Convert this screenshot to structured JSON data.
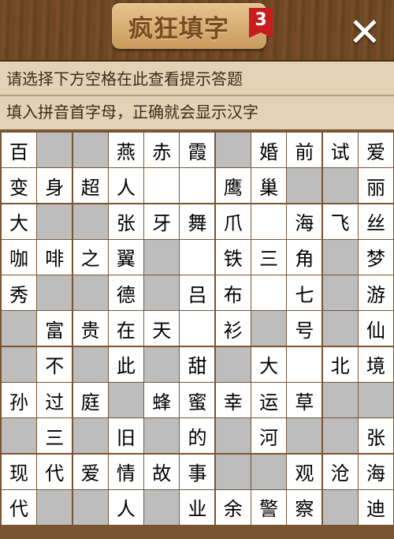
{
  "header": {
    "title": "疯狂填字",
    "level": "3",
    "close_label": "✕"
  },
  "hint": {
    "line1": "请选择下方空格在此查看提示答题",
    "line2": "填入拼音首字母，正确就会显示汉字"
  },
  "grid": {
    "rows": [
      [
        "百",
        null,
        null,
        "燕",
        "赤",
        "霞",
        null,
        "婚",
        "前",
        "试",
        "爱"
      ],
      [
        "变",
        "身",
        "超",
        "人",
        "",
        "",
        "鹰",
        "巢",
        null,
        null,
        "丽"
      ],
      [
        "大",
        null,
        null,
        "张",
        "牙",
        "舞",
        "爪",
        "",
        "海",
        "飞",
        "丝"
      ],
      [
        "咖",
        "啡",
        "之",
        "翼",
        null,
        "",
        "铁",
        "三",
        "角",
        null,
        "梦"
      ],
      [
        "秀",
        null,
        null,
        "德",
        null,
        "吕",
        "布",
        "",
        "七",
        null,
        "游"
      ],
      [
        null,
        "富",
        "贵",
        "在",
        "天",
        "",
        "衫",
        null,
        "号",
        null,
        "仙"
      ],
      [
        null,
        "不",
        null,
        "此",
        null,
        "甜",
        null,
        "大",
        "",
        "北",
        "境"
      ],
      [
        "孙",
        "过",
        "庭",
        null,
        "蜂",
        "蜜",
        "幸",
        "运",
        "草",
        null,
        null
      ],
      [
        null,
        "三",
        null,
        "旧",
        null,
        "的",
        null,
        "河",
        null,
        null,
        "张"
      ],
      [
        "现",
        "代",
        "爱",
        "情",
        "故",
        "事",
        null,
        null,
        "观",
        "沧",
        "海"
      ],
      [
        "代",
        null,
        null,
        "人",
        null,
        "业",
        "余",
        "警",
        "察",
        null,
        "迪"
      ]
    ]
  }
}
